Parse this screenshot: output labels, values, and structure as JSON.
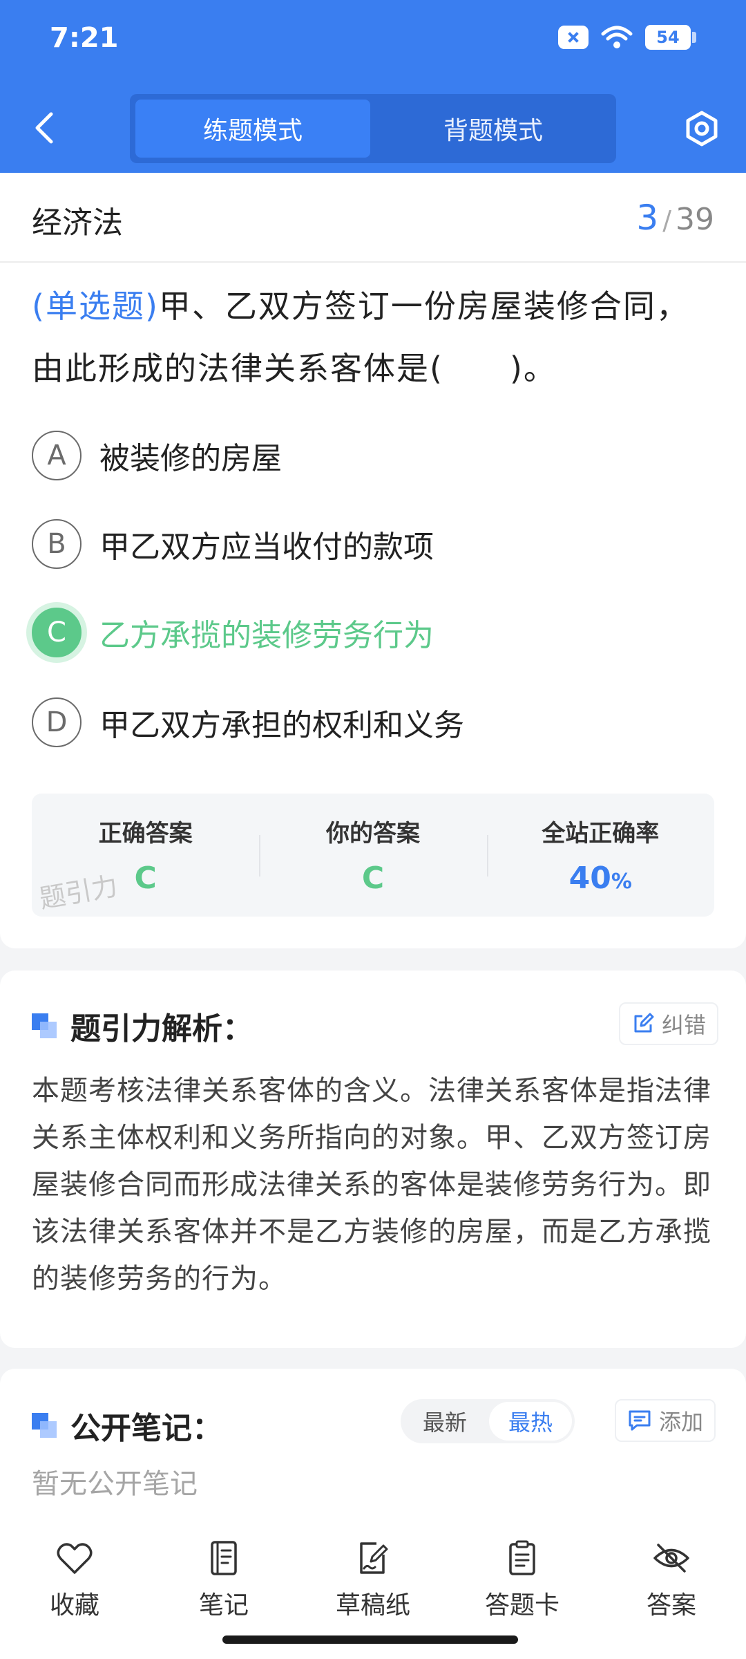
{
  "status_bar": {
    "time": "7:21",
    "battery": "54"
  },
  "header": {
    "tabs": [
      {
        "label": "练题模式",
        "active": true
      },
      {
        "label": "背题模式",
        "active": false
      }
    ]
  },
  "subject": {
    "title": "经济法",
    "current": "3",
    "total": "39",
    "separator": "/"
  },
  "question": {
    "type_label": "(单选题)",
    "text": "甲、乙双方签订一份房屋装修合同，由此形成的法律关系客体是(　　)。",
    "options": [
      {
        "letter": "A",
        "text": "被装修的房屋",
        "state": "normal"
      },
      {
        "letter": "B",
        "text": "甲乙双方应当收付的款项",
        "state": "normal"
      },
      {
        "letter": "C",
        "text": "乙方承揽的装修劳务行为",
        "state": "correct"
      },
      {
        "letter": "D",
        "text": "甲乙双方承担的权利和义务",
        "state": "normal"
      }
    ]
  },
  "answer_summary": {
    "correct_label": "正确答案",
    "correct_value": "C",
    "yours_label": "你的答案",
    "yours_value": "C",
    "rate_label": "全站正确率",
    "rate_value": "40",
    "rate_unit": "%",
    "watermark": "题引力"
  },
  "analysis": {
    "title": "题引力解析：",
    "report_label": "纠错",
    "text": "本题考核法律关系客体的含义。法律关系客体是指法律关系主体权利和义务所指向的对象。甲、乙双方签订房屋装修合同而形成法律关系的客体是装修劳务行为。即该法律关系客体并不是乙方装修的房屋，而是乙方承揽的装修劳务的行为。"
  },
  "notes": {
    "title": "公开笔记：",
    "sort_new": "最新",
    "sort_hot": "最热",
    "add_label": "添加",
    "empty_text": "暂无公开笔记"
  },
  "bottom_nav": [
    {
      "label": "收藏",
      "icon": "heart-icon"
    },
    {
      "label": "笔记",
      "icon": "notebook-icon"
    },
    {
      "label": "草稿纸",
      "icon": "draft-icon"
    },
    {
      "label": "答题卡",
      "icon": "answer-card-icon"
    },
    {
      "label": "答案",
      "icon": "eye-off-icon"
    }
  ],
  "colors": {
    "primary": "#3a7ef0",
    "correct": "#5cc98a"
  }
}
